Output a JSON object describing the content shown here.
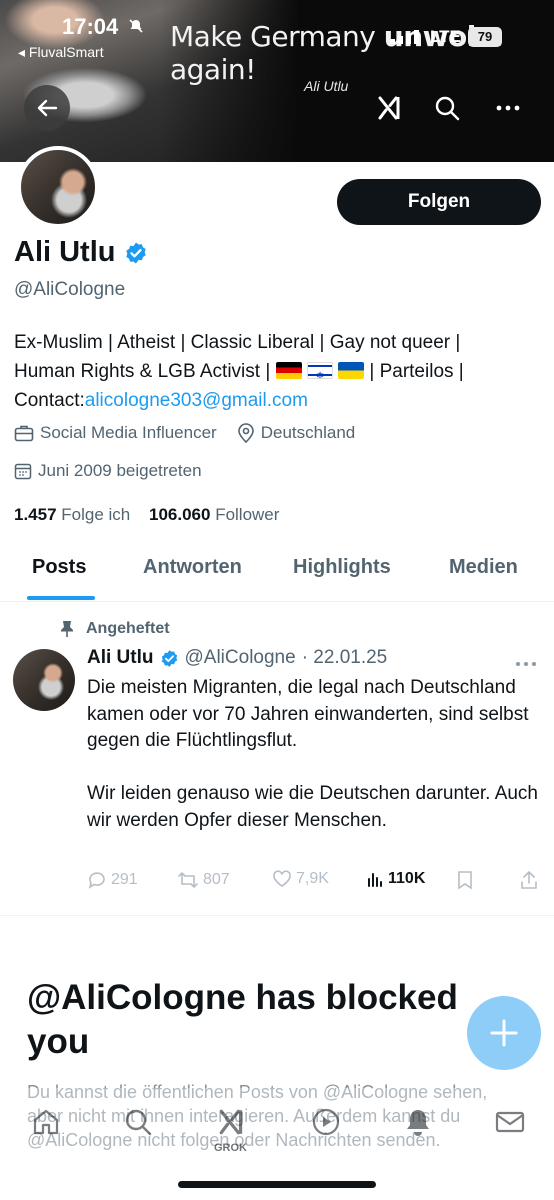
{
  "status_bar": {
    "time": "17:04",
    "carrier": "◂ FluvalSmart",
    "network": "LTE",
    "battery": "79"
  },
  "banner": {
    "caption_regular": "Make Germany ",
    "caption_bold": "unwoke",
    "caption_end": " again!",
    "signature": "Ali Utlu"
  },
  "profile": {
    "follow_label": "Folgen",
    "name": "Ali Utlu",
    "handle": "@AliCologne",
    "bio_line1": "Ex-Muslim | Atheist | Classic Liberal | Gay not queer |",
    "bio_line2a": "Human Rights & LGB Activist |",
    "bio_line2b": "| Parteilos |",
    "bio_contact_label": "Contact:",
    "bio_email": "alicologne303@gmail.com",
    "category": "Social Media Influencer",
    "location": "Deutschland",
    "joined": "Juni 2009 beigetreten",
    "following_count": "1.457",
    "following_label": "Folge ich",
    "followers_count": "106.060",
    "followers_label": "Follower"
  },
  "tabs": [
    "Posts",
    "Antworten",
    "Highlights",
    "Medien"
  ],
  "tweet": {
    "pinned_label": "Angeheftet",
    "name": "Ali Utlu",
    "handle": "@AliCologne",
    "date": "· 22.01.25",
    "text": "Die meisten Migranten, die legal nach Deutschland kamen oder vor 70 Jahren einwanderten, sind selbst gegen die Flüchtlingsflut.\n\nWir leiden genauso wie die Deutschen darunter. Auch wir werden Opfer dieser Menschen.",
    "replies": "291",
    "reposts": "807",
    "likes": "7,9K",
    "views": "110K"
  },
  "blocked": {
    "title": "@AliCologne has blocked you",
    "text": "Du kannst die öffentlichen Posts von @AliCologne sehen, aber nicht mit ihnen interagieren. Außerdem kannst du @AliCologne nicht folgen oder Nachrichten senden."
  },
  "nav": {
    "grok_label": "GROK"
  }
}
